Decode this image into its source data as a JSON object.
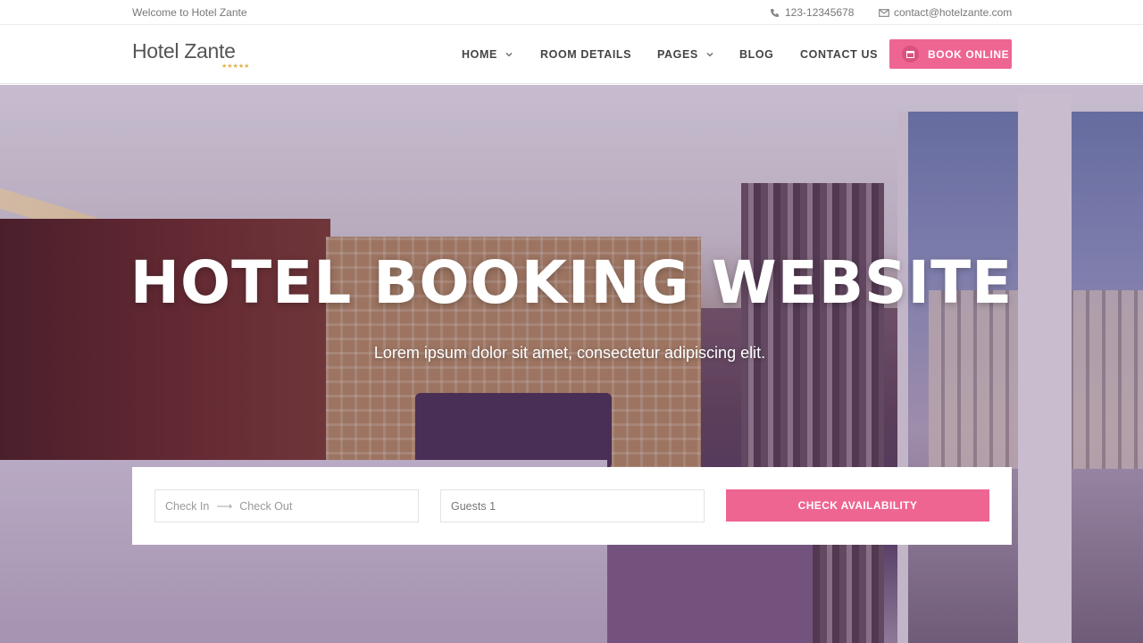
{
  "topbar": {
    "welcome": "Welcome to Hotel Zante",
    "phone": "123-12345678",
    "email": "contact@hotelzante.com"
  },
  "header": {
    "logo": "Hotel Zante",
    "logo_stars": "★★★★★",
    "nav": [
      {
        "label": "HOME",
        "has_dropdown": true
      },
      {
        "label": "ROOM DETAILS",
        "has_dropdown": false
      },
      {
        "label": "PAGES",
        "has_dropdown": true
      },
      {
        "label": "BLOG",
        "has_dropdown": false
      },
      {
        "label": "CONTACT US",
        "has_dropdown": false
      }
    ],
    "book_button": "BOOK ONLINE"
  },
  "hero": {
    "title": "HOTEL BOOKING WEBSITE",
    "subtitle": "Lorem ipsum dolor sit amet, consectetur adipiscing elit."
  },
  "booking": {
    "check_in_placeholder": "Check In",
    "arrow": "⟶",
    "check_out_placeholder": "Check Out",
    "guests_value": "Guests 1",
    "button": "CHECK AVAILABILITY"
  },
  "colors": {
    "accent": "#ee6592",
    "text_dark": "#444444",
    "text_muted": "#777777"
  },
  "icons": {
    "phone": "phone-icon",
    "email": "envelope-icon",
    "calendar": "calendar-icon",
    "dropdown": "chevron-down-icon"
  }
}
